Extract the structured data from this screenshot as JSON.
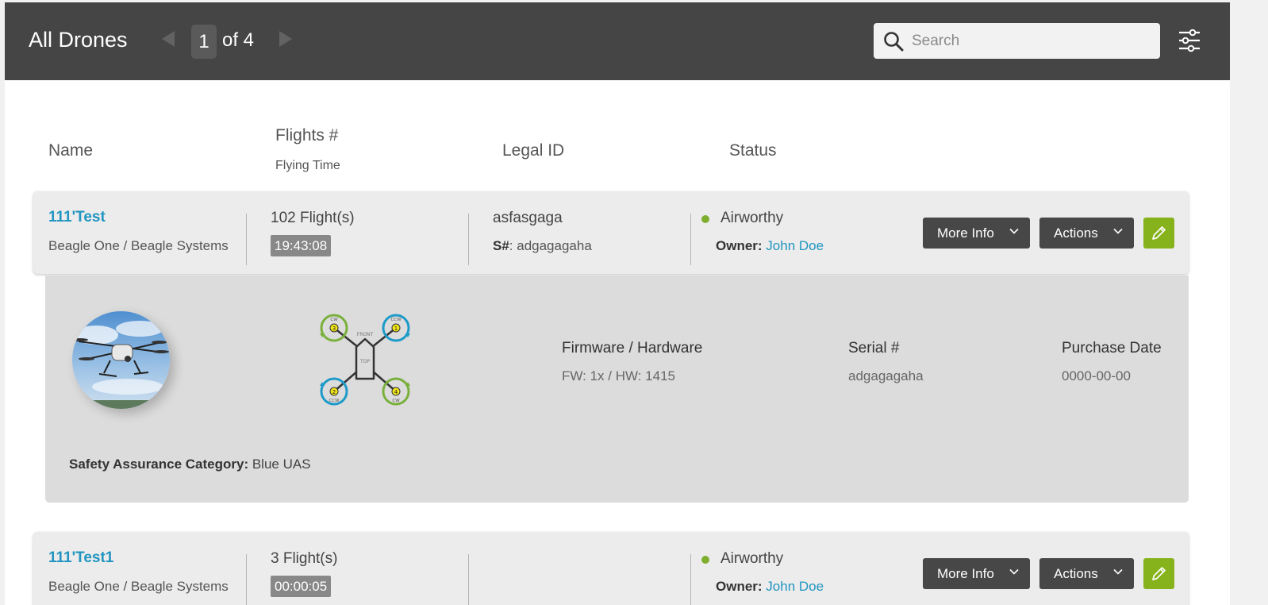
{
  "header": {
    "title": "All Drones",
    "current_page": "1",
    "page_of": "of 4",
    "search_placeholder": "Search"
  },
  "columns": {
    "name": "Name",
    "flights": "Flights #",
    "flying_time": "Flying Time",
    "legal_id": "Legal ID",
    "status": "Status"
  },
  "drones": [
    {
      "name": "111'Test",
      "model": "Beagle One / Beagle Systems",
      "flights": "102 Flight(s)",
      "flying_time": "19:43:08",
      "legal_id": "asfasgaga",
      "serial_label": "S#",
      "serial_value": ": adgagagaha",
      "status": "Airworthy",
      "owner_label": "Owner:",
      "owner_name": "John Doe",
      "more_info": "More Info",
      "actions": "Actions"
    },
    {
      "name": "111'Test1",
      "model": "Beagle One / Beagle Systems",
      "flights": "3 Flight(s)",
      "flying_time": "00:00:05",
      "legal_id": "",
      "status": "Airworthy",
      "owner_label": "Owner:",
      "owner_name": "John Doe",
      "more_info": "More Info",
      "actions": "Actions"
    }
  ],
  "details": {
    "firmware_label": "Firmware / Hardware",
    "firmware_value": "FW: 1x / HW: 1415",
    "serial_label": "Serial #",
    "serial_value": "adgagagaha",
    "purchase_label": "Purchase Date",
    "purchase_value": "0000-00-00",
    "sac_label": "Safety Assurance Category:",
    "sac_value": " Blue UAS",
    "motors": [
      {
        "number": "3",
        "direction": "CW"
      },
      {
        "number": "1",
        "direction": "CCW"
      },
      {
        "number": "2",
        "direction": "CCW"
      },
      {
        "number": "4",
        "direction": "CW"
      }
    ],
    "front_label": "FRONT",
    "top_label": "TOP"
  },
  "colors": {
    "topbar": "#454545",
    "link": "#2295c1",
    "status_ok": "#7fae2f",
    "edit_button": "#86b21b",
    "cw_motor": "#7ab03c",
    "ccw_motor": "#1d9ac8"
  }
}
